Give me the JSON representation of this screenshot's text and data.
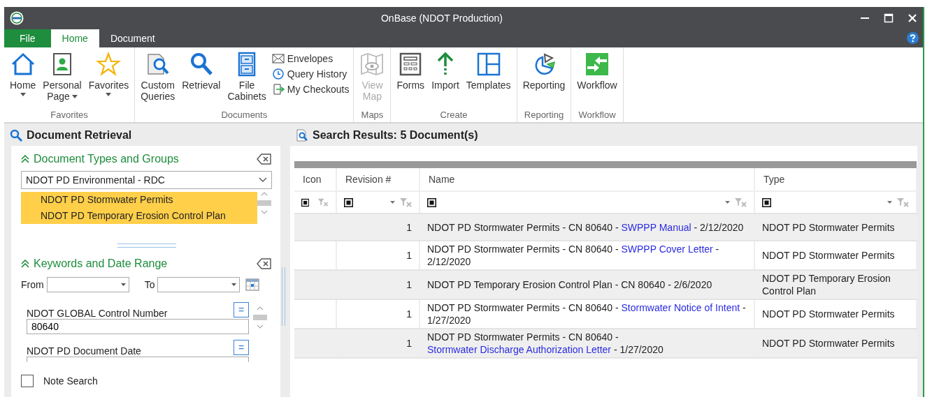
{
  "window": {
    "title": "OnBase (NDOT Production)"
  },
  "menu_tabs": [
    {
      "label": "File",
      "kind": "file",
      "selected": false
    },
    {
      "label": "Home",
      "kind": "tab",
      "selected": true
    },
    {
      "label": "Document",
      "kind": "tab",
      "selected": false
    }
  ],
  "ribbon": [
    {
      "group": "Favorites",
      "items": [
        {
          "label": "Home",
          "kind": "large",
          "dropdown": true,
          "disabled": false
        },
        {
          "label": "Personal Page",
          "kind": "large",
          "dropdown": true,
          "disabled": false
        },
        {
          "label": "Favorites",
          "kind": "large",
          "dropdown": true,
          "disabled": false
        }
      ]
    },
    {
      "group": "Documents",
      "items": [
        {
          "label": "Custom Queries",
          "kind": "large",
          "dropdown": false,
          "disabled": false
        },
        {
          "label": "Retrieval",
          "kind": "large",
          "dropdown": false,
          "disabled": false
        },
        {
          "label": "File Cabinets",
          "kind": "large",
          "dropdown": false,
          "disabled": false
        },
        {
          "label": "Envelopes",
          "kind": "small"
        },
        {
          "label": "Query History",
          "kind": "small"
        },
        {
          "label": "My Checkouts",
          "kind": "small"
        }
      ]
    },
    {
      "group": "Maps",
      "items": [
        {
          "label": "View Map",
          "kind": "large",
          "dropdown": false,
          "disabled": true
        }
      ]
    },
    {
      "group": "Create",
      "items": [
        {
          "label": "Forms",
          "kind": "large",
          "dropdown": false,
          "disabled": false
        },
        {
          "label": "Import",
          "kind": "large",
          "dropdown": false,
          "disabled": false
        },
        {
          "label": "Templates",
          "kind": "large",
          "dropdown": false,
          "disabled": false
        }
      ]
    },
    {
      "group": "Reporting",
      "items": [
        {
          "label": "Reporting",
          "kind": "large",
          "dropdown": false,
          "disabled": false
        }
      ]
    },
    {
      "group": "Workflow",
      "items": [
        {
          "label": "Workflow",
          "kind": "large",
          "dropdown": false,
          "disabled": false
        }
      ]
    }
  ],
  "retrieval": {
    "title": "Document Retrieval",
    "doc_types": {
      "title": "Document Types and Groups",
      "expanded": true,
      "group_value": "NDOT PD Environmental - RDC",
      "items": [
        {
          "label": "NDOT PD Stormwater Permits",
          "selected": true
        },
        {
          "label": "NDOT PD Temporary Erosion Control Plan",
          "selected": true
        }
      ]
    },
    "keywords": {
      "title": "Keywords and Date Range",
      "expanded": true,
      "from_label": "From",
      "to_label": "To",
      "fields": [
        {
          "label": "NDOT GLOBAL Control Number",
          "operator": "=",
          "value": "80640"
        },
        {
          "label": "NDOT PD Document Date",
          "operator": "="
        }
      ]
    },
    "note_search": {
      "label": "Note Search",
      "checked": false
    }
  },
  "results": {
    "title": "Search Results: 5 Document(s)",
    "columns": [
      "Icon",
      "Revision #",
      "Name",
      "Type"
    ],
    "rows": [
      {
        "revision": "1",
        "name": [
          {
            "text": "NDOT PD Stormwater Permits - CN 80640 - ",
            "link": false
          },
          {
            "text": "SWPPP Manual",
            "link": true
          },
          {
            "text": " - 2/12/2020",
            "link": false
          }
        ],
        "type": "NDOT PD Stormwater Permits"
      },
      {
        "revision": "1",
        "name": [
          {
            "text": "NDOT PD Stormwater Permits - CN 80640 - ",
            "link": false
          },
          {
            "text": "SWPPP Cover Letter",
            "link": true
          },
          {
            "text": " - 2/12/2020",
            "link": false
          }
        ],
        "type": "NDOT PD Stormwater Permits"
      },
      {
        "revision": "1",
        "name": [
          {
            "text": "NDOT PD Temporary Erosion Control Plan - CN 80640 - 2/6/2020",
            "link": false
          }
        ],
        "type": "NDOT PD Temporary Erosion Control Plan"
      },
      {
        "revision": "1",
        "name": [
          {
            "text": "NDOT PD Stormwater Permits - CN 80640 - ",
            "link": false
          },
          {
            "text": "Stormwater Notice of Intent",
            "link": true
          },
          {
            "text": " - 1/27/2020",
            "link": false
          }
        ],
        "type": "NDOT PD Stormwater Permits"
      },
      {
        "revision": "1",
        "name": [
          {
            "text": "NDOT PD Stormwater Permits - CN 80640 - ",
            "link": false
          },
          {
            "text": "Stormwater Discharge Authorization Letter",
            "link": true
          },
          {
            "text": " - 1/27/2020",
            "link": false
          }
        ],
        "type": "NDOT PD Stormwater Permits"
      }
    ]
  }
}
